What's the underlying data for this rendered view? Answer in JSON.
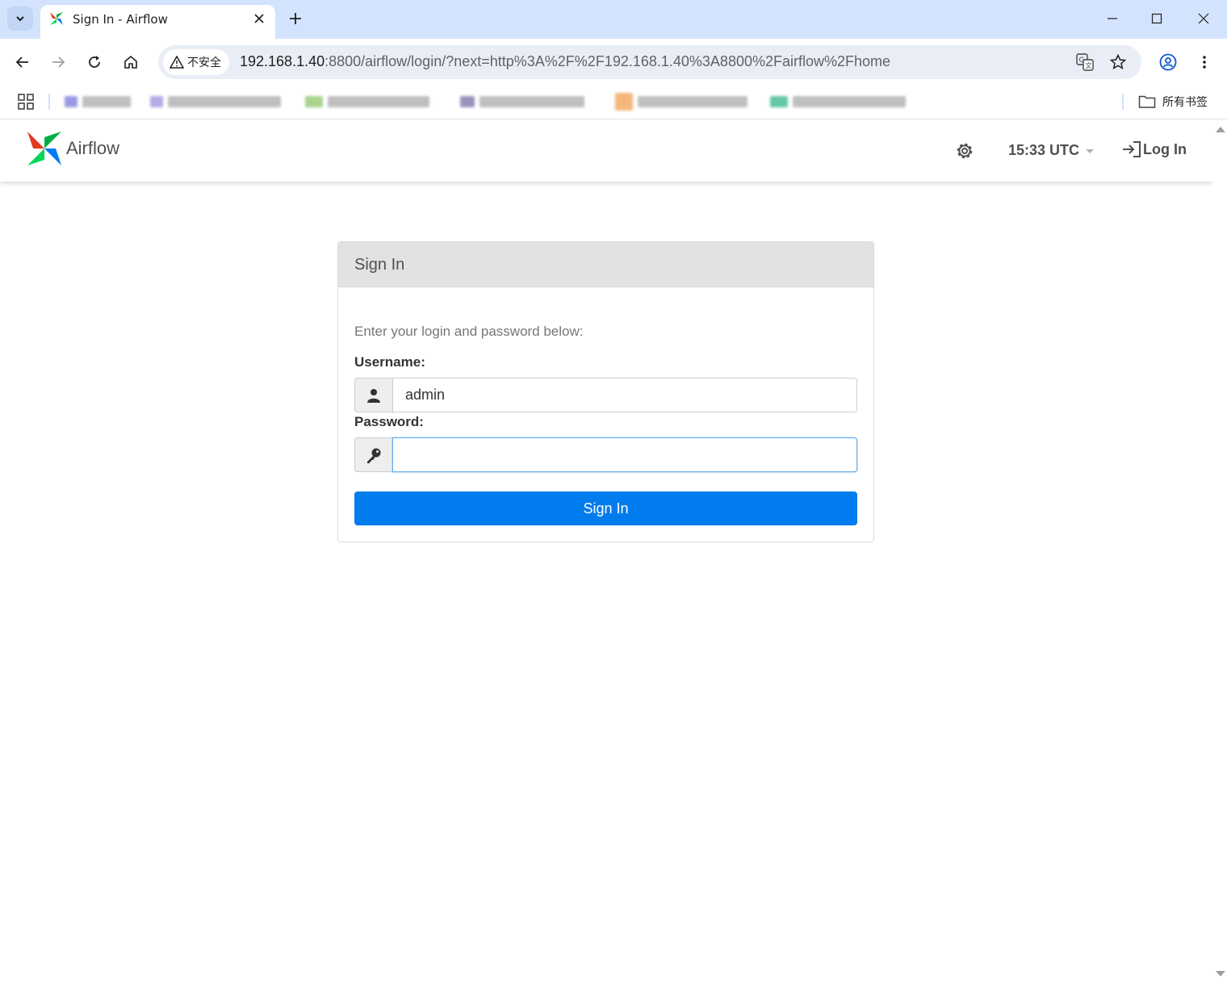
{
  "browser": {
    "tab": {
      "title": "Sign In - Airflow"
    },
    "security_label": "不安全",
    "url_host": "192.168.1.40",
    "url_rest": ":8800/airflow/login/?next=http%3A%2F%2F192.168.1.40%3A8800%2Fairflow%2Fhome",
    "bookmarks_folder": "所有书签",
    "bookmark_colors": [
      "#7a7adb",
      "#9b8fe0",
      "#8fc46a",
      "#7a6fa8",
      "#f0a050",
      "#2fb58a"
    ]
  },
  "navbar": {
    "brand": "Airflow",
    "time": "15:33 UTC",
    "login": "Log In"
  },
  "signin": {
    "heading": "Sign In",
    "hint": "Enter your login and password below:",
    "username_label": "Username:",
    "username_value": "admin",
    "password_label": "Password:",
    "password_value": "",
    "button": "Sign In"
  },
  "colors": {
    "primary": "#017cee",
    "tabstrip": "#d3e3fd"
  }
}
